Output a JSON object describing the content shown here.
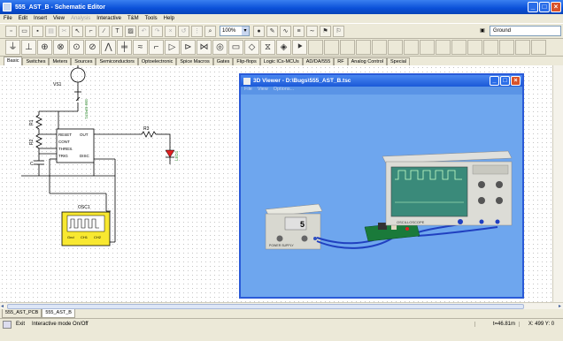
{
  "window": {
    "title": "555_AST_B - Schematic Editor"
  },
  "menu": [
    {
      "label": "File",
      "enabled": true
    },
    {
      "label": "Edit",
      "enabled": true
    },
    {
      "label": "Insert",
      "enabled": true
    },
    {
      "label": "View",
      "enabled": true
    },
    {
      "label": "Analysis",
      "enabled": false
    },
    {
      "label": "Interactive",
      "enabled": true
    },
    {
      "label": "T&M",
      "enabled": true
    },
    {
      "label": "Tools",
      "enabled": true
    },
    {
      "label": "Help",
      "enabled": true
    }
  ],
  "toolbar": {
    "zoom": "100%",
    "layer": "Ground"
  },
  "component_tabs": [
    "Basic",
    "Switches",
    "Meters",
    "Sources",
    "Semiconductors",
    "Optoelectronic",
    "Spice Macros",
    "Gates",
    "Flip-flops",
    "Logic ICs-MCUs",
    "AD/DA/555",
    "RF",
    "Analog Control",
    "Special"
  ],
  "schematic": {
    "labels": {
      "vs1": "VS1",
      "sw": "SW-SPST1",
      "r1": "R1",
      "r2": "R2",
      "r3": "R3",
      "c": "C",
      "led": "LED1",
      "osc": "OSC1",
      "ic_reset": "RESET",
      "ic_out": "OUT",
      "ic_cont": "CONT",
      "ic_thres": "THRES.",
      "ic_trig": "TRIG",
      "ic_disc": "DISC",
      "osc_ch1": "Gnd",
      "osc_ch2": "CH1",
      "osc_ch3": "CH2"
    }
  },
  "viewer": {
    "title": "3D Viewer - D:\\Bugs\\555_AST_B.tsc",
    "menu": [
      "File",
      "View",
      "Options..."
    ],
    "psu_display": "5",
    "psu_label": "POWER SUPPLY",
    "scope_label": "OSCILLOSCOPE"
  },
  "sheet_tabs": [
    "555_AST_PCB",
    "555_AST_B"
  ],
  "status": {
    "exit": "Exit",
    "message": "Interactive mode On/Off",
    "time": "t=46.81m",
    "coords": "X: 499 Y: 0"
  },
  "colors": {
    "title_bar": "#0a4fd8",
    "viewer_bg": "#6fa4ec",
    "schematic_wire": "#000000",
    "led": "#e02020"
  }
}
